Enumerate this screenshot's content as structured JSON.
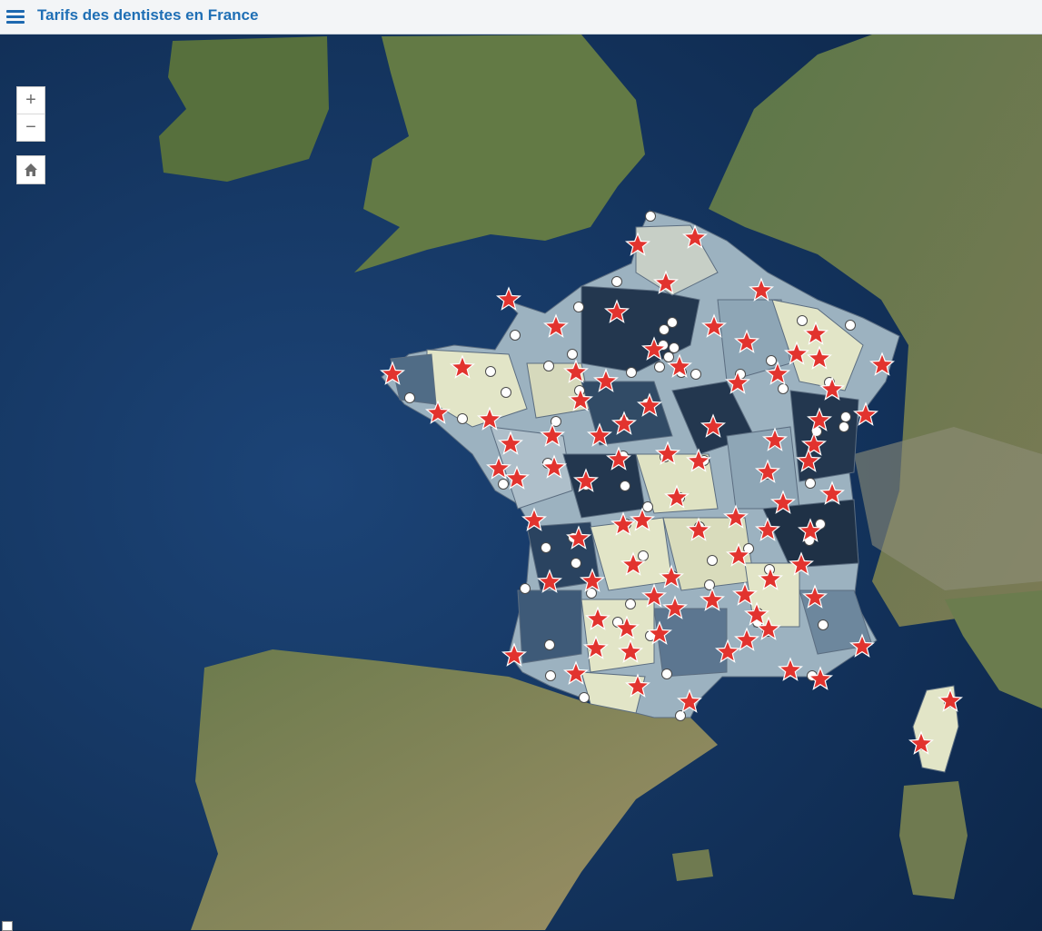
{
  "app": {
    "title": "Tarifs des dentistes en France"
  },
  "controls": {
    "zoom_in_label": "+",
    "zoom_out_label": "−",
    "menu_icon": "hamburger-menu-icon",
    "home_icon": "home-icon"
  },
  "colors": {
    "sea": "#17386a",
    "land": "#4f6b3e",
    "france_light": "#e2e5c7",
    "france_mid": "#9cb2c0",
    "france_dark": "#23374f",
    "star": "#e2332e",
    "point": "#ffffff"
  },
  "layers": {
    "choropleth": "departments",
    "markers": [
      "red-star",
      "white-circle"
    ]
  }
}
